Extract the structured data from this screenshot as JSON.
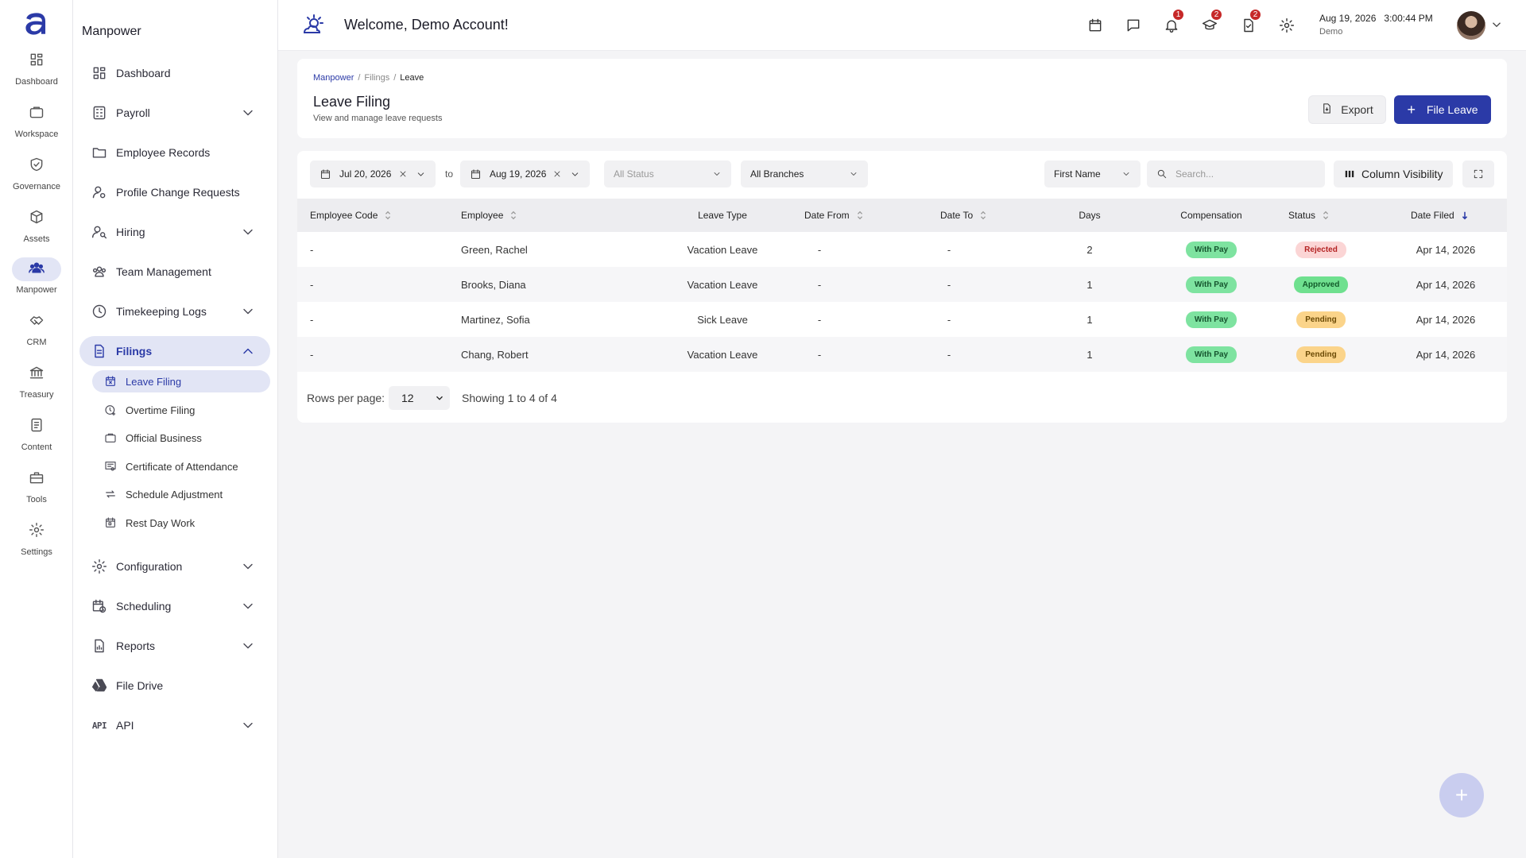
{
  "rail": {
    "items": [
      {
        "label": "Dashboard",
        "icon": "dashboard-icon"
      },
      {
        "label": "Workspace",
        "icon": "briefcase-icon"
      },
      {
        "label": "Governance",
        "icon": "shield-check-icon"
      },
      {
        "label": "Assets",
        "icon": "cube-icon"
      },
      {
        "label": "Manpower",
        "icon": "people-icon"
      },
      {
        "label": "CRM",
        "icon": "handshake-icon"
      },
      {
        "label": "Treasury",
        "icon": "bank-icon"
      },
      {
        "label": "Content",
        "icon": "document-icon"
      },
      {
        "label": "Tools",
        "icon": "toolbox-icon"
      },
      {
        "label": "Settings",
        "icon": "gear-icon"
      }
    ]
  },
  "sidebar": {
    "title": "Manpower",
    "items": [
      {
        "label": "Dashboard"
      },
      {
        "label": "Payroll"
      },
      {
        "label": "Employee Records"
      },
      {
        "label": "Profile Change Requests"
      },
      {
        "label": "Hiring"
      },
      {
        "label": "Team Management"
      },
      {
        "label": "Timekeeping Logs"
      },
      {
        "label": "Filings"
      },
      {
        "label": "Configuration"
      },
      {
        "label": "Scheduling"
      },
      {
        "label": "Reports"
      },
      {
        "label": "File Drive"
      },
      {
        "label": "API",
        "glyph": "API"
      }
    ],
    "filings_sub": [
      {
        "label": "Leave Filing"
      },
      {
        "label": "Overtime Filing"
      },
      {
        "label": "Official Business"
      },
      {
        "label": "Certificate of Attendance"
      },
      {
        "label": "Schedule Adjustment"
      },
      {
        "label": "Rest Day Work"
      }
    ]
  },
  "topbar": {
    "welcome": "Welcome, Demo Account!",
    "badges": {
      "notifications": "1",
      "training": "2",
      "tasks": "2"
    },
    "date": "Aug 19, 2026",
    "time": "3:00:44 PM",
    "user": "Demo"
  },
  "header": {
    "breadcrumb": [
      "Manpower",
      "Filings",
      "Leave"
    ],
    "title": "Leave Filing",
    "subtitle": "View and manage leave requests",
    "export_label": "Export",
    "file_label": "File Leave"
  },
  "filters": {
    "date_from": "Jul 20, 2026",
    "to_label": "to",
    "date_to": "Aug 19, 2026",
    "status_placeholder": "All Status",
    "branches": "All Branches",
    "search_field": "First Name",
    "search_placeholder": "Search...",
    "column_visibility": "Column Visibility"
  },
  "table": {
    "columns": [
      "Employee Code",
      "Employee",
      "Leave Type",
      "Date From",
      "Date To",
      "Days",
      "Compensation",
      "Status",
      "Date Filed"
    ],
    "rows": [
      {
        "code": "-",
        "employee": "Green, Rachel",
        "leave_type": "Vacation Leave",
        "date_from": "-",
        "date_to": "-",
        "days": "2",
        "compensation": "With Pay",
        "status": "Rejected",
        "date_filed": "Apr 14, 2026"
      },
      {
        "code": "-",
        "employee": "Brooks, Diana",
        "leave_type": "Vacation Leave",
        "date_from": "-",
        "date_to": "-",
        "days": "1",
        "compensation": "With Pay",
        "status": "Approved",
        "date_filed": "Apr 14, 2026"
      },
      {
        "code": "-",
        "employee": "Martinez, Sofia",
        "leave_type": "Sick Leave",
        "date_from": "-",
        "date_to": "-",
        "days": "1",
        "compensation": "With Pay",
        "status": "Pending",
        "date_filed": "Apr 14, 2026"
      },
      {
        "code": "-",
        "employee": "Chang, Robert",
        "leave_type": "Vacation Leave",
        "date_from": "-",
        "date_to": "-",
        "days": "1",
        "compensation": "With Pay",
        "status": "Pending",
        "date_filed": "Apr 14, 2026"
      }
    ]
  },
  "pagination": {
    "rows_label": "Rows per page:",
    "rows_value": "12",
    "showing": "Showing 1 to 4 of 4"
  },
  "fab": {
    "label": "+"
  },
  "colors": {
    "accent": "#2b3aa7",
    "active_bg": "#e2e5f5",
    "badge": "#c62828"
  }
}
